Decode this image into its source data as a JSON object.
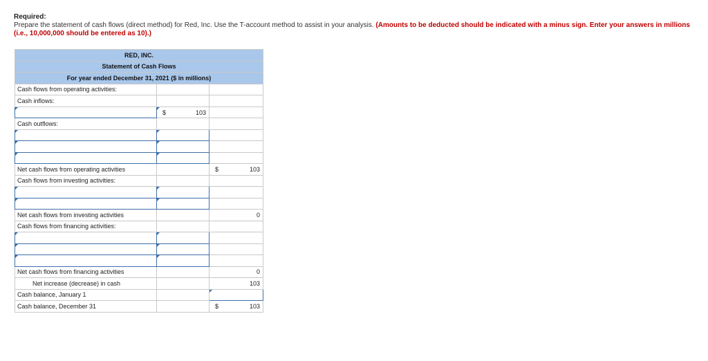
{
  "instructions": {
    "heading": "Required:",
    "text": "Prepare the statement of cash flows (direct method) for Red, Inc. Use the T-account method to assist in your analysis.",
    "note": "(Amounts to be deducted should be indicated with a minus sign. Enter your answers in millions (i.e., 10,000,000 should be entered as 10).)"
  },
  "statement": {
    "company": "RED, INC.",
    "title": "Statement of Cash Flows",
    "period": "For year ended December 31, 2021 ($ in millions)",
    "currency_symbol": "$",
    "rows": {
      "operating_header": "Cash flows from operating activities:",
      "cash_inflows": "Cash inflows:",
      "inflow_1_value": "103",
      "cash_outflows": "Cash outflows:",
      "net_operating": "Net cash flows from operating activities",
      "net_operating_value": "103",
      "investing_header": "Cash flows from investing activities:",
      "net_investing": "Net cash flows from investing activities",
      "net_investing_value": "0",
      "financing_header": "Cash flows from financing activities:",
      "net_financing": "Net cash flows from financing activities",
      "net_financing_value": "0",
      "net_increase": "Net increase (decrease) in cash",
      "net_increase_value": "103",
      "balance_jan": "Cash balance, January 1",
      "balance_dec": "Cash balance, December 31",
      "balance_dec_value": "103"
    }
  }
}
